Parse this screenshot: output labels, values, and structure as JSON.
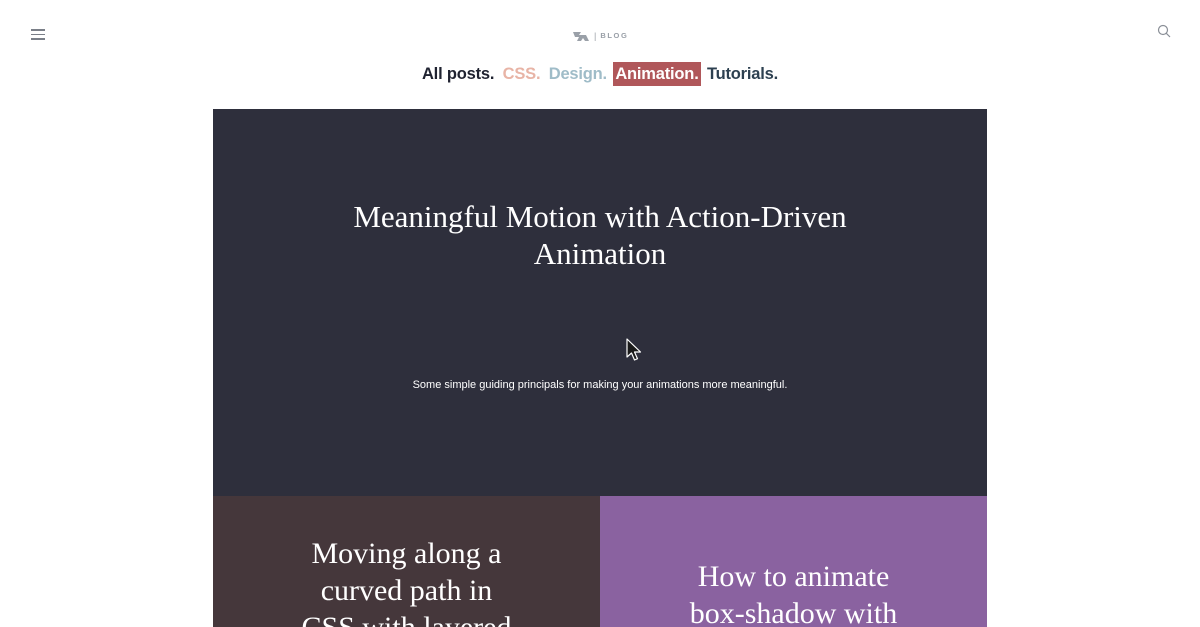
{
  "header": {
    "logo_text": "BLOG",
    "logo_separator": "|",
    "menu_icon": "hamburger-menu-icon",
    "search_icon": "search-icon"
  },
  "categories": [
    {
      "label": "All posts.",
      "color": "#1f2230"
    },
    {
      "label": "CSS.",
      "color": "#e8b4a6"
    },
    {
      "label": "Design.",
      "color": "#9fbcc8"
    },
    {
      "label": "Animation.",
      "color": "#b0575a",
      "active": true
    },
    {
      "label": "Tutorials.",
      "color": "#2d4050"
    }
  ],
  "featured": {
    "title_line1": "Meaningful Motion with Action-Driven",
    "title_line2": "Animation",
    "description": "Some simple guiding principals for making your animations more meaningful.",
    "background": "#2e2f3c"
  },
  "posts": [
    {
      "title_line1": "Moving along a",
      "title_line2": "curved path in",
      "title_line3": "CSS with layered",
      "background": "#45373b"
    },
    {
      "title_line1": "How to animate",
      "title_line2": "box-shadow with",
      "background": "#8a62a0"
    }
  ]
}
